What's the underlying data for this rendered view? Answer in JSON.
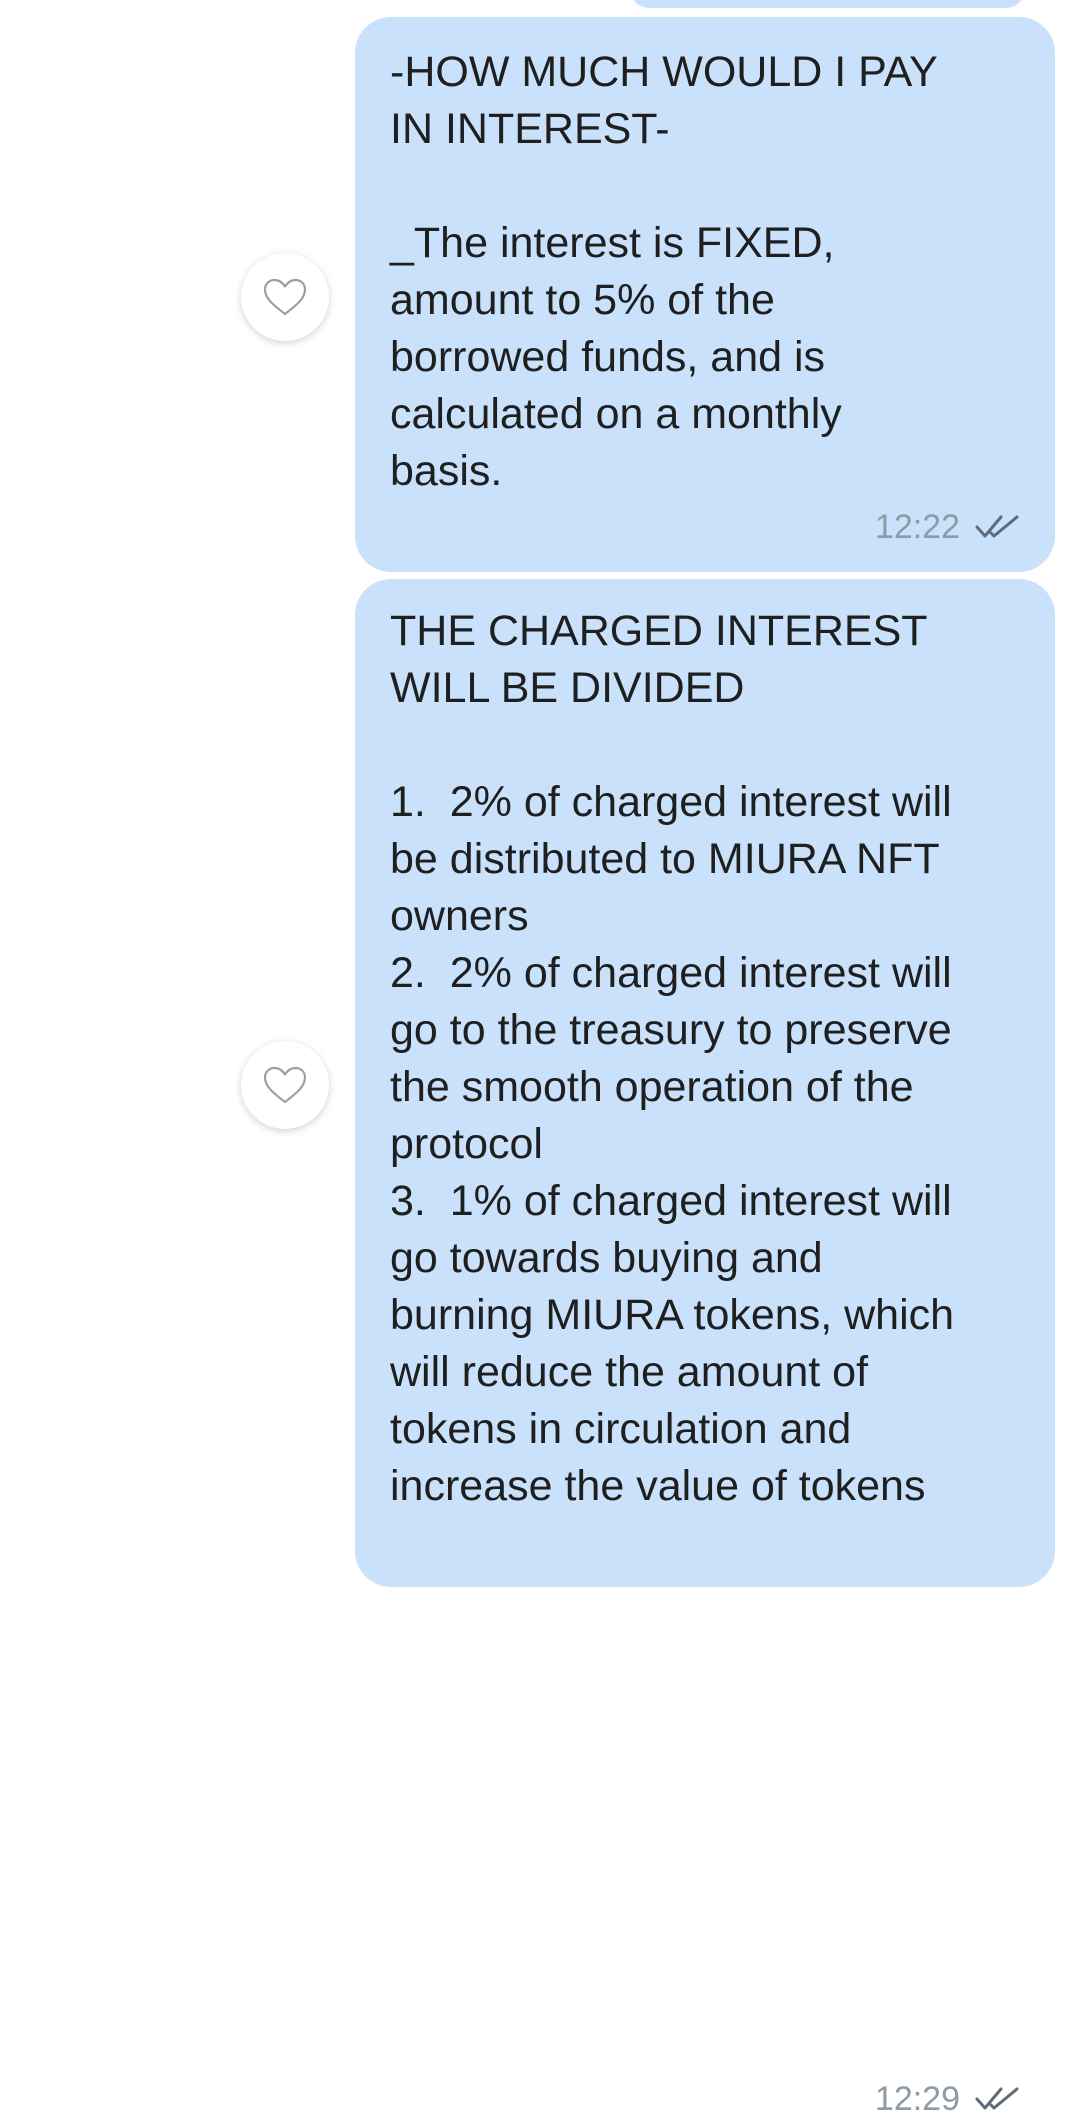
{
  "messages": [
    {
      "text": "-HOW MUCH WOULD I PAY\nIN INTEREST-\n\n_The interest is FIXED,\namount to 5% of the\nborrowed funds, and is\ncalculated on a monthly\nbasis.",
      "time": "12:22",
      "status_icon": "double-check-icon",
      "reaction_icon": "heart-outline-icon"
    },
    {
      "text": "THE CHARGED INTEREST\nWILL BE DIVIDED\n\n1.  2% of charged interest will\nbe distributed to MIURA NFT\nowners\n2.  2% of charged interest will\ngo to the treasury to preserve\nthe smooth operation of the\nprotocol\n3.  1% of charged interest will\ngo towards buying and\nburning MIURA tokens, which\nwill reduce the amount of\ntokens in circulation and\nincrease the value of tokens",
      "time": "12:29",
      "status_icon": "double-check-icon",
      "reaction_icon": "heart-outline-icon"
    }
  ],
  "colors": {
    "bubble_background": "#c9e1fa",
    "text": "#1f1f1f",
    "timestamp": "#8e9aa6",
    "background": "#ffffff"
  }
}
